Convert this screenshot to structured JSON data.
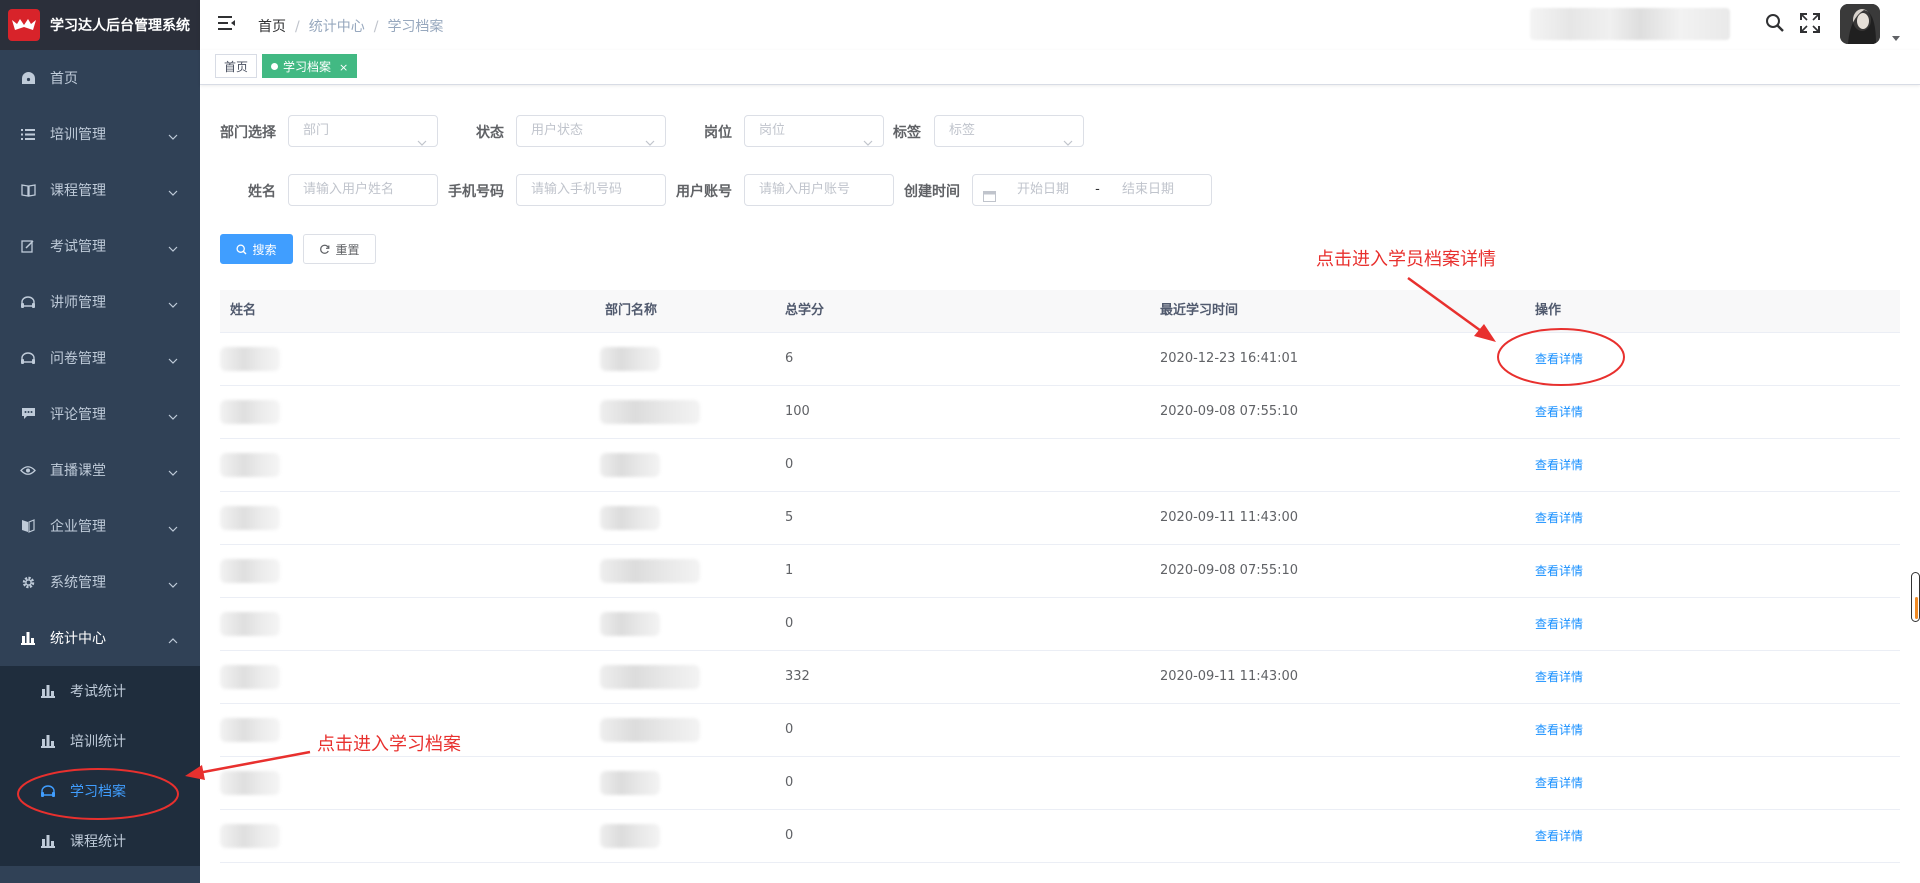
{
  "app": {
    "title": "学习达人后台管理系统"
  },
  "sidebar": {
    "items": [
      {
        "label": "首页",
        "icon": "dashboard-icon"
      },
      {
        "label": "培训管理",
        "icon": "list-icon"
      },
      {
        "label": "课程管理",
        "icon": "book-icon"
      },
      {
        "label": "考试管理",
        "icon": "edit-icon"
      },
      {
        "label": "讲师管理",
        "icon": "guide-icon"
      },
      {
        "label": "问卷管理",
        "icon": "guide-icon"
      },
      {
        "label": "评论管理",
        "icon": "message-icon"
      },
      {
        "label": "直播课堂",
        "icon": "eye-icon"
      },
      {
        "label": "企业管理",
        "icon": "documentation-icon"
      },
      {
        "label": "系统管理",
        "icon": "gear-icon"
      },
      {
        "label": "统计中心",
        "icon": "chart-icon"
      }
    ],
    "subitems": [
      {
        "label": "考试统计",
        "icon": "chart-icon"
      },
      {
        "label": "培训统计",
        "icon": "chart-icon"
      },
      {
        "label": "学习档案",
        "icon": "guide-icon"
      },
      {
        "label": "课程统计",
        "icon": "chart-icon"
      }
    ]
  },
  "breadcrumb": {
    "home": "首页",
    "parent": "统计中心",
    "current": "学习档案"
  },
  "tags": {
    "home": "首页",
    "active": "学习档案"
  },
  "filters": {
    "dept_label": "部门选择",
    "dept_placeholder": "部门",
    "status_label": "状态",
    "status_placeholder": "用户状态",
    "post_label": "岗位",
    "post_placeholder": "岗位",
    "tag_label": "标签",
    "tag_placeholder": "标签",
    "name_label": "姓名",
    "name_placeholder": "请输入用户姓名",
    "phone_label": "手机号码",
    "phone_placeholder": "请输入手机号码",
    "account_label": "用户账号",
    "account_placeholder": "请输入用户账号",
    "created_label": "创建时间",
    "start_placeholder": "开始日期",
    "range_sep": "-",
    "end_placeholder": "结束日期",
    "search_button": "搜索",
    "reset_button": "重置"
  },
  "table": {
    "columns": {
      "name": "姓名",
      "dept": "部门名称",
      "credits": "总学分",
      "last_study": "最近学习时间",
      "action": "操作"
    },
    "action_label": "查看详情",
    "rows": [
      {
        "credits": "6",
        "last_study": "2020-12-23 16:41:01"
      },
      {
        "credits": "100",
        "last_study": "2020-09-08 07:55:10"
      },
      {
        "credits": "0",
        "last_study": ""
      },
      {
        "credits": "5",
        "last_study": "2020-09-11 11:43:00"
      },
      {
        "credits": "1",
        "last_study": "2020-09-08 07:55:10"
      },
      {
        "credits": "0",
        "last_study": ""
      },
      {
        "credits": "332",
        "last_study": "2020-09-11 11:43:00"
      },
      {
        "credits": "0",
        "last_study": ""
      },
      {
        "credits": "0",
        "last_study": ""
      },
      {
        "credits": "0",
        "last_study": ""
      }
    ]
  },
  "annotations": {
    "detail_hint": "点击进入学员档案详情",
    "archive_hint": "点击进入学习档案"
  },
  "colors": {
    "sidebar_bg": "#304156",
    "accent": "#409eff",
    "tag_active": "#42b983",
    "annotation": "#e8302e"
  }
}
